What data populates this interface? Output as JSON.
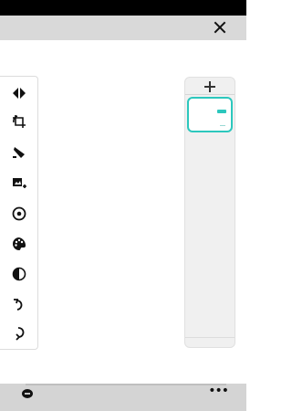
{
  "top_bar": {
    "close_icon": "close-icon"
  },
  "toolbar": {
    "tools": [
      {
        "name": "collapse-tool",
        "icon": "diamond-arrows-icon"
      },
      {
        "name": "crop-rotate-tool",
        "icon": "crop-rotate-icon"
      },
      {
        "name": "brush-tool",
        "icon": "brush-icon"
      },
      {
        "name": "add-image-tool",
        "icon": "add-image-icon"
      },
      {
        "name": "visibility-tool",
        "icon": "eye-icon"
      },
      {
        "name": "color-palette-tool",
        "icon": "palette-icon"
      },
      {
        "name": "contrast-tool",
        "icon": "contrast-icon"
      },
      {
        "name": "undo-tool",
        "icon": "undo-icon"
      },
      {
        "name": "redo-tool",
        "icon": "redo-icon"
      }
    ]
  },
  "pages_panel": {
    "add_icon": "plus-icon",
    "selected_page": 1
  },
  "bottom_bar": {
    "chat_icon": "chat-icon",
    "more_label": "•••"
  },
  "colors": {
    "accent": "#2cc7bd",
    "panel_bg": "#f0f0f0",
    "bar_bg": "#d9d9d9"
  }
}
